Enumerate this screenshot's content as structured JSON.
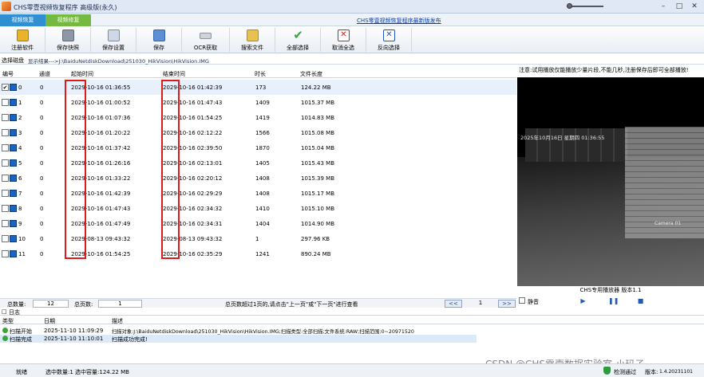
{
  "window": {
    "title": "CHS零壹视频恢复程序 高级版(永久)",
    "link": "CHS零壹视频恢复程序最新版发布"
  },
  "tabs": [
    {
      "label": "视频恢复"
    },
    {
      "label": "视频修复"
    }
  ],
  "toolbar": [
    {
      "label": "注册软件",
      "icon": "register-icon"
    },
    {
      "label": "保存快照",
      "icon": "snapshot-icon"
    },
    {
      "label": "保存设置",
      "icon": "settings-icon"
    },
    {
      "label": "保存",
      "icon": "save-icon"
    },
    {
      "label": "OCR获取",
      "icon": "ocr-icon"
    },
    {
      "label": "搜索文件",
      "icon": "search-file-icon"
    },
    {
      "label": "全部选择",
      "icon": "check-icon"
    },
    {
      "label": "取消全选",
      "icon": "cancel-icon"
    },
    {
      "label": "反向选择",
      "icon": "invert-icon"
    }
  ],
  "path": {
    "label": "选择磁盘",
    "value": "显示结果--->J:\\BaiduNetdiskDownload\\251030_HikVision\\HikVision.IMG"
  },
  "notice": "注意:试用播放仅能播放少量片段,不能几秒,注册保存后即可全部播放!",
  "columns": [
    "编号",
    "通道",
    "起始时间",
    "结束时间",
    "时长",
    "文件长度"
  ],
  "rows": [
    {
      "id": "0",
      "channel": "0",
      "start": "2029-10-16 01:36:55",
      "end": "2029-10-16 01:42:39",
      "duration": "173",
      "size": "124.22 MB",
      "checked": "✔"
    },
    {
      "id": "1",
      "channel": "0",
      "start": "2029-10-16 01:00:52",
      "end": "2029-10-16 01:47:43",
      "duration": "1409",
      "size": "1015.37 MB",
      "checked": ""
    },
    {
      "id": "2",
      "channel": "0",
      "start": "2029-10-16 01:07:36",
      "end": "2029-10-16 01:54:25",
      "duration": "1419",
      "size": "1014.83 MB",
      "checked": ""
    },
    {
      "id": "3",
      "channel": "0",
      "start": "2029-10-16 01:20:22",
      "end": "2029-10-16 02:12:22",
      "duration": "1566",
      "size": "1015.08 MB",
      "checked": ""
    },
    {
      "id": "4",
      "channel": "0",
      "start": "2029-10-16 01:37:42",
      "end": "2029-10-16 02:39:50",
      "duration": "1870",
      "size": "1015.04 MB",
      "checked": ""
    },
    {
      "id": "5",
      "channel": "0",
      "start": "2029-10-16 01:26:16",
      "end": "2029-10-16 02:13:01",
      "duration": "1405",
      "size": "1015.43 MB",
      "checked": ""
    },
    {
      "id": "6",
      "channel": "0",
      "start": "2029-10-16 01:33:22",
      "end": "2029-10-16 02:20:12",
      "duration": "1408",
      "size": "1015.39 MB",
      "checked": ""
    },
    {
      "id": "7",
      "channel": "0",
      "start": "2029-10-16 01:42:39",
      "end": "2029-10-16 02:29:29",
      "duration": "1408",
      "size": "1015.17 MB",
      "checked": ""
    },
    {
      "id": "8",
      "channel": "0",
      "start": "2029-10-16 01:47:43",
      "end": "2029-10-16 02:34:32",
      "duration": "1410",
      "size": "1015.10 MB",
      "checked": ""
    },
    {
      "id": "9",
      "channel": "0",
      "start": "2029-10-16 01:47:49",
      "end": "2029-10-16 02:34:31",
      "duration": "1404",
      "size": "1014.90 MB",
      "checked": ""
    },
    {
      "id": "10",
      "channel": "0",
      "start": "2029-08-13 09:43:32",
      "end": "2029-08-13 09:43:32",
      "duration": "1",
      "size": "297.96 KB",
      "checked": ""
    },
    {
      "id": "11",
      "channel": "0",
      "start": "2029-10-16 01:54:25",
      "end": "2029-10-16 02:35:29",
      "duration": "1241",
      "size": "890.24 MB",
      "checked": ""
    }
  ],
  "status": {
    "total_label": "总数量:",
    "total": "12",
    "pages_label": "总页数:",
    "pages": "1",
    "hint": "总页数超过1页的,请点击\"上一页\"或\"下一页\"进行查看",
    "prev": "<<",
    "page": "1",
    "next": ">>"
  },
  "preview": {
    "osd_time": "2025年10月16日 星期四 01:36:55",
    "osd_cam": "Camera 01"
  },
  "player": {
    "title": "CHS专用播放器 版本1.1",
    "mute": "静音"
  },
  "log": {
    "title": "日志",
    "columns": [
      "类型",
      "日期",
      "描述"
    ],
    "rows": [
      {
        "type": "扫描开始",
        "date": "2025-11-10 11:09:29",
        "desc": "扫描对象:J:\\BaiduNetdiskDownload\\251030_HikVision\\HikVision.IMG;扫描类型:全部扫描;文件系统:RAW;扫描范围:0~20971520"
      },
      {
        "type": "扫描完成",
        "date": "2025-11-10 11:10:01",
        "desc": "扫描成功完成!"
      }
    ]
  },
  "bottom": {
    "state": "就绪",
    "selection": "选中数量:1 选中容量:124.22 MB",
    "detect": "检测通过",
    "version_label": "版本:",
    "version": "1.4.20231101"
  },
  "watermark": "CSDN @CHS零壹数据实验室-小玛子"
}
